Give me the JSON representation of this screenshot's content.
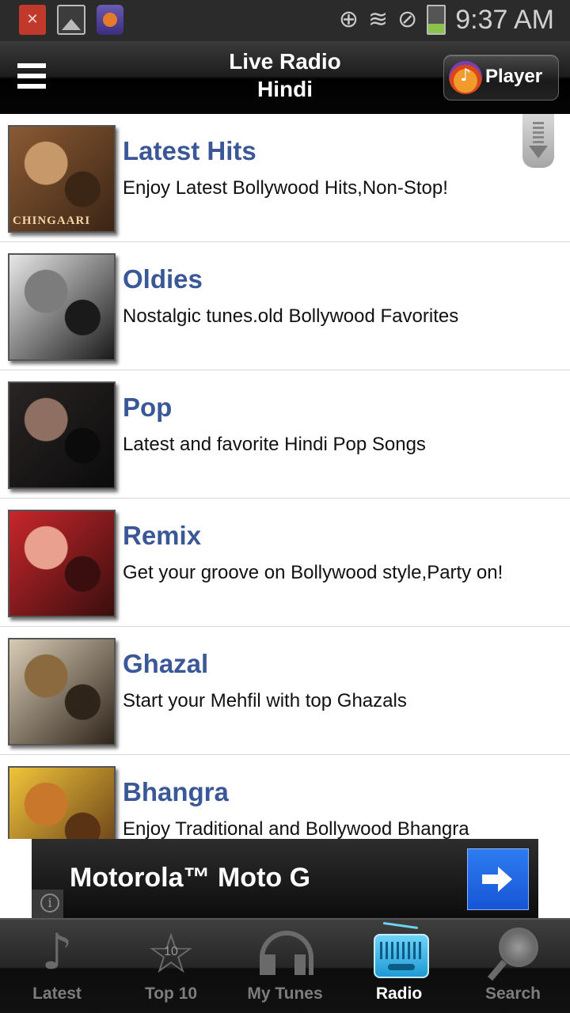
{
  "status_bar": {
    "time": "9:37 AM",
    "icons": [
      "file-error-icon",
      "image-icon",
      "app-notification-icon",
      "vibrate-icon",
      "wifi-icon",
      "do-not-disturb-icon",
      "battery-icon"
    ]
  },
  "header": {
    "title_line1": "Live Radio",
    "title_line2": "Hindi",
    "player_label": "Player"
  },
  "stations": [
    {
      "title": "Latest Hits",
      "description": "Enjoy Latest Bollywood Hits,Non-Stop!",
      "thumb_caption": "CHINGAARI",
      "colors": [
        "#8a5a33",
        "#c7986a",
        "#3b2515"
      ]
    },
    {
      "title": "Oldies",
      "description": "Nostalgic tunes.old Bollywood Favorites",
      "thumb_caption": "",
      "colors": [
        "#e8e8e8",
        "#7c7c7c",
        "#1a1a1a"
      ]
    },
    {
      "title": "Pop",
      "description": "Latest and favorite Hindi Pop Songs",
      "thumb_caption": "",
      "colors": [
        "#2a2424",
        "#8e6f62",
        "#0b0b0b"
      ]
    },
    {
      "title": "Remix",
      "description": "Get your groove on Bollywood style,Party on!",
      "thumb_caption": "",
      "colors": [
        "#c8262b",
        "#e9a08f",
        "#3a0e0e"
      ]
    },
    {
      "title": "Ghazal",
      "description": "Start your Mehfil with top Ghazals",
      "thumb_caption": "",
      "colors": [
        "#d8cbb5",
        "#8a6a3e",
        "#2f241a"
      ]
    },
    {
      "title": "Bhangra",
      "description": "Enjoy Traditional and Bollywood Bhangra",
      "thumb_caption": "",
      "colors": [
        "#f0c43a",
        "#c9772b",
        "#5a3214"
      ]
    }
  ],
  "ad": {
    "text": "Motorola™ Moto G"
  },
  "tabs": [
    {
      "label": "Latest",
      "icon": "music-note-icon"
    },
    {
      "label": "Top 10",
      "icon": "star-icon",
      "badge": "10"
    },
    {
      "label": "My Tunes",
      "icon": "headphones-icon"
    },
    {
      "label": "Radio",
      "icon": "radio-icon",
      "active": true
    },
    {
      "label": "Search",
      "icon": "search-icon"
    }
  ]
}
